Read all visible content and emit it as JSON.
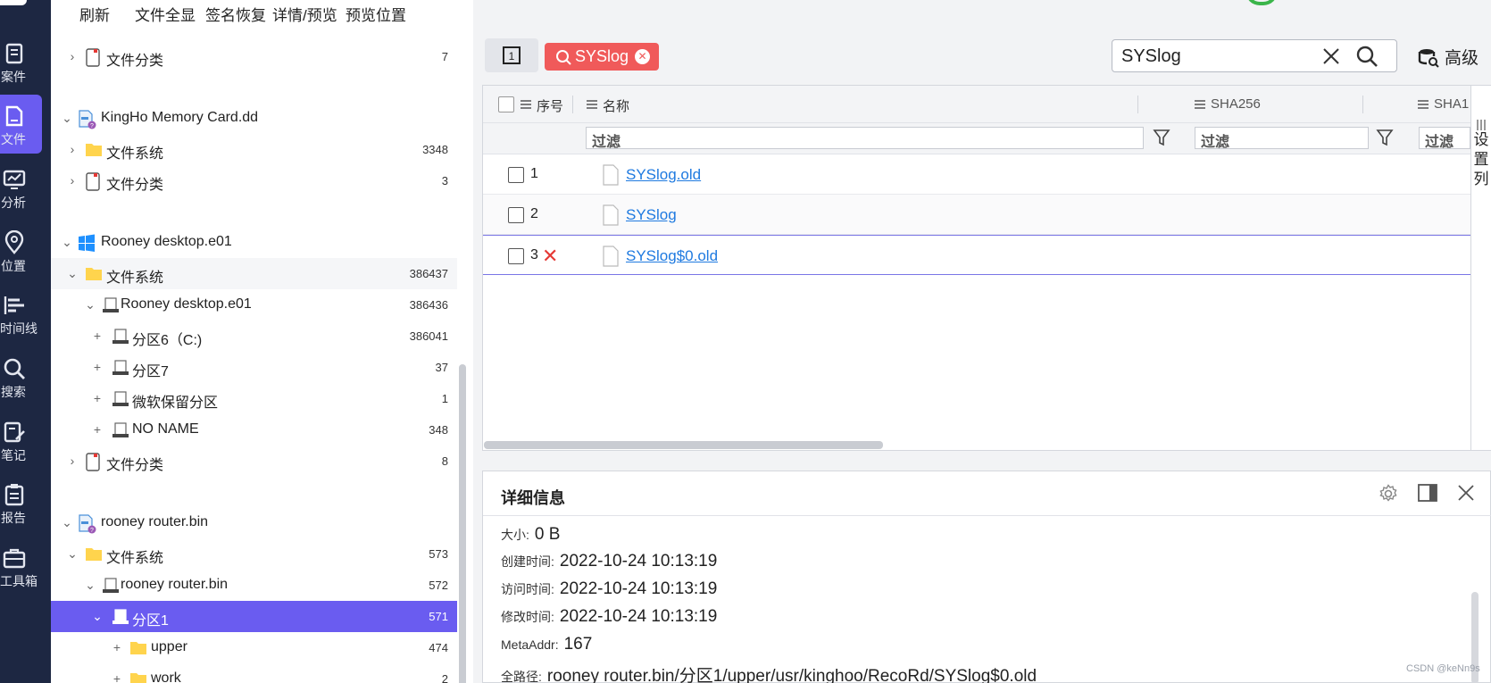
{
  "menu": {
    "refresh": "刷新",
    "full_view": "文件全显",
    "sign_restore": "签名恢复",
    "detail_preview": "详情/预览",
    "preview_position": "预览位置"
  },
  "rail": [
    {
      "label": "案件",
      "icon": "case-icon"
    },
    {
      "label": "文件",
      "icon": "file-icon"
    },
    {
      "label": "分析",
      "icon": "analysis-icon"
    },
    {
      "label": "位置",
      "icon": "location-icon"
    },
    {
      "label": "时间线",
      "icon": "timeline-icon"
    },
    {
      "label": "搜索",
      "icon": "search-icon"
    },
    {
      "label": "笔记",
      "icon": "note-icon"
    },
    {
      "label": "报告",
      "icon": "report-icon"
    },
    {
      "label": "工具箱",
      "icon": "toolbox-icon"
    }
  ],
  "tree": [
    {
      "label": "文件分类",
      "count": "7",
      "toggle": "›",
      "icon": "category-icon"
    },
    {
      "label": "KingHo Memory Card.dd",
      "count": "",
      "toggle": "⌄",
      "icon": "image-file-icon"
    },
    {
      "label": "文件系统",
      "count": "3348",
      "toggle": "›",
      "icon": "folder-icon"
    },
    {
      "label": "文件分类",
      "count": "3",
      "toggle": "›",
      "icon": "category-icon"
    },
    {
      "label": "Rooney desktop.e01",
      "count": "",
      "toggle": "⌄",
      "icon": "windows-icon"
    },
    {
      "label": "文件系统",
      "count": "386437",
      "toggle": "⌄",
      "icon": "folder-icon"
    },
    {
      "label": "Rooney desktop.e01",
      "count": "386436",
      "toggle": "⌄",
      "icon": "disk-icon"
    },
    {
      "label": "分区6（C:)",
      "count": "386041",
      "toggle": "+",
      "icon": "disk-icon"
    },
    {
      "label": "分区7",
      "count": "37",
      "toggle": "+",
      "icon": "disk-icon"
    },
    {
      "label": "微软保留分区",
      "count": "1",
      "toggle": "+",
      "icon": "disk-icon"
    },
    {
      "label": "NO NAME",
      "count": "348",
      "toggle": "+",
      "icon": "disk-icon"
    },
    {
      "label": "文件分类",
      "count": "8",
      "toggle": "›",
      "icon": "category-icon"
    },
    {
      "label": "rooney router.bin",
      "count": "",
      "toggle": "⌄",
      "icon": "image-file-icon"
    },
    {
      "label": "文件系统",
      "count": "573",
      "toggle": "⌄",
      "icon": "folder-icon"
    },
    {
      "label": "rooney router.bin",
      "count": "572",
      "toggle": "⌄",
      "icon": "disk-icon"
    },
    {
      "label": "分区1",
      "count": "571",
      "toggle": "⌄",
      "icon": "disk-icon"
    },
    {
      "label": "upper",
      "count": "474",
      "toggle": "+",
      "icon": "folder-icon"
    },
    {
      "label": "work",
      "count": "2",
      "toggle": "+",
      "icon": "folder-icon"
    }
  ],
  "search": {
    "tag": "SYSlog",
    "value": "SYSlog",
    "advanced": "高级"
  },
  "grid": {
    "col_index": "序号",
    "col_name": "名称",
    "col_sha256": "SHA256",
    "col_sha1": "SHA1",
    "filter_placeholder": "过滤",
    "settings_label": "设置列",
    "rows": [
      {
        "num": "1",
        "name": "SYSlog.old",
        "deleted": false
      },
      {
        "num": "2",
        "name": "SYSlog",
        "deleted": false
      },
      {
        "num": "3",
        "name": "SYSlog$0.old",
        "deleted": true
      }
    ]
  },
  "detail": {
    "title": "详细信息",
    "size_label": "大小:",
    "size": "0 B",
    "created_label": "创建时间:",
    "created": "2022-10-24 10:13:19",
    "accessed_label": "访问时间:",
    "accessed": "2022-10-24 10:13:19",
    "modified_label": "修改时间:",
    "modified": "2022-10-24 10:13:19",
    "meta_label": "MetaAddr:",
    "meta": "167",
    "path_label": "全路径:",
    "path": "rooney router.bin/分区1/upper/usr/kinghoo/RecoRd/SYSlog$0.old"
  },
  "watermark": "CSDN @keNn9s",
  "colors": {
    "accent": "#6a5cf0",
    "rail": "#1d2742",
    "chip": "#f05a5a",
    "link": "#1f7ae0"
  }
}
